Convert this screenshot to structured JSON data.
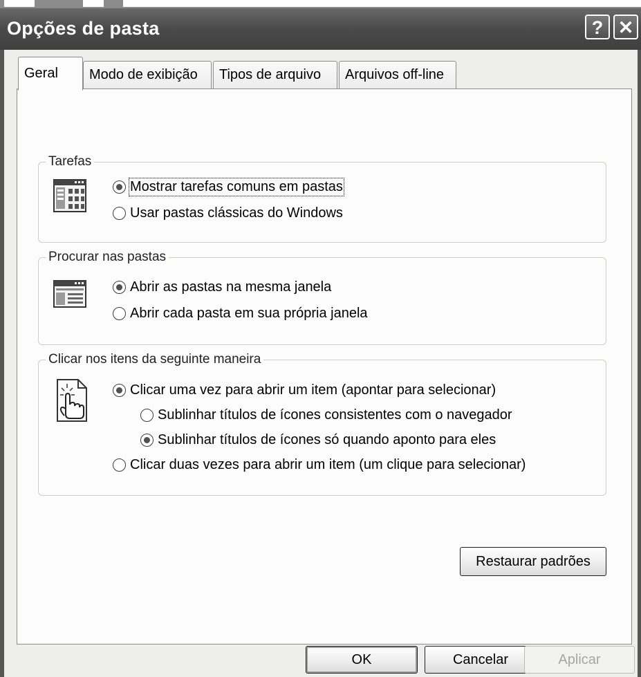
{
  "window": {
    "title": "Opções de pasta",
    "help_glyph": "?",
    "close_glyph": "✕"
  },
  "tabs": [
    {
      "label": "Geral",
      "active": true
    },
    {
      "label": "Modo de exibição",
      "active": false
    },
    {
      "label": "Tipos de arquivo",
      "active": false
    },
    {
      "label": "Arquivos off-line",
      "active": false
    }
  ],
  "groups": {
    "tasks": {
      "title": "Tarefas",
      "icon": "task-pane-folder-icon",
      "options": [
        {
          "label": "Mostrar tarefas comuns em pastas",
          "selected": true
        },
        {
          "label": "Usar pastas clássicas do Windows",
          "selected": false
        }
      ]
    },
    "browse": {
      "title": "Procurar nas pastas",
      "icon": "window-icon",
      "options": [
        {
          "label": "Abrir as pastas na mesma janela",
          "selected": true
        },
        {
          "label": "Abrir cada pasta em sua própria janela",
          "selected": false
        }
      ]
    },
    "click": {
      "title": "Clicar nos itens da seguinte maneira",
      "icon": "hand-pointer-icon",
      "options": [
        {
          "label": "Clicar uma vez para abrir um item (apontar para selecionar)",
          "selected": true
        },
        {
          "label": "Sublinhar títulos de ícones consistentes com o navegador",
          "selected": false
        },
        {
          "label": "Sublinhar títulos de ícones só quando aponto para eles",
          "selected": true
        },
        {
          "label": "Clicar duas vezes para abrir um item (um clique para selecionar)",
          "selected": false
        }
      ]
    }
  },
  "buttons": {
    "restore": "Restaurar padrões",
    "ok": "OK",
    "cancel": "Cancelar",
    "apply": "Aplicar"
  }
}
